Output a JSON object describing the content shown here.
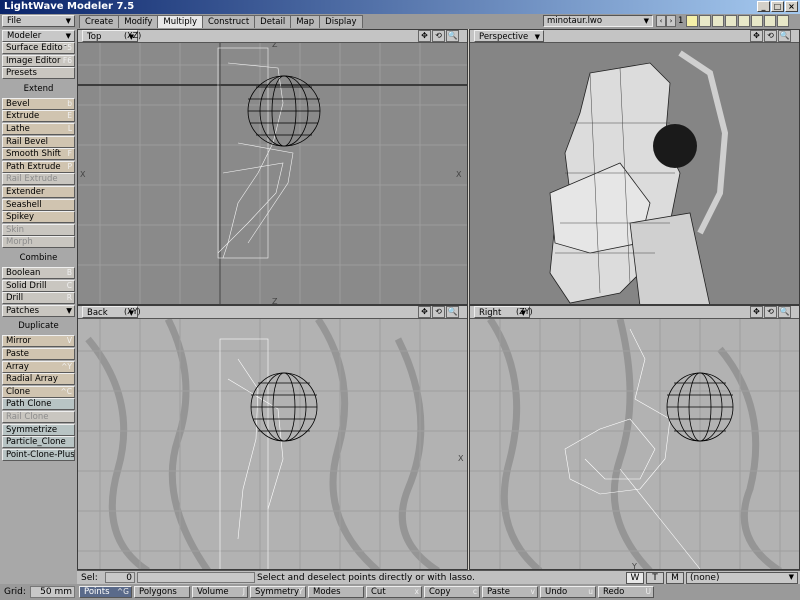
{
  "window": {
    "title": "LightWave Modeler 7.5",
    "min_glyph": "_",
    "max_glyph": "□",
    "close_glyph": "×"
  },
  "toolbar": {
    "file": "File",
    "modeler": "Modeler",
    "tabs": [
      "Create",
      "Modify",
      "Multiply",
      "Construct",
      "Detail",
      "Map",
      "Display"
    ],
    "active_tab": "Multiply",
    "object": "minotaur.lwo",
    "prev_arrow": "‹",
    "next_arrow": "›",
    "layer_number": "1"
  },
  "sidebar": {
    "top_items": [
      {
        "label": "Surface Editor",
        "key": "F5"
      },
      {
        "label": "Image Editor",
        "key": "F6"
      },
      {
        "label": "Presets",
        "key": ""
      }
    ],
    "groups": [
      {
        "title": "Extend",
        "items": [
          {
            "label": "Bevel",
            "key": "b",
            "state": "orange"
          },
          {
            "label": "Extrude",
            "key": "E",
            "state": "orange"
          },
          {
            "label": "Lathe",
            "key": "L",
            "state": "orange"
          },
          {
            "label": "Rail Bevel",
            "key": "",
            "state": "orange"
          },
          {
            "label": "Smooth Shift",
            "key": "F",
            "state": "orange"
          },
          {
            "label": "Path Extrude",
            "key": "P",
            "state": "orange"
          },
          {
            "label": "Rail Extrude",
            "key": "",
            "state": "disabled"
          },
          {
            "label": "Extender",
            "key": "",
            "state": "orange"
          },
          {
            "label": "Seashell",
            "key": "",
            "state": "orange"
          },
          {
            "label": "Spikey",
            "key": "",
            "state": "orange"
          },
          {
            "label": "Skin",
            "key": "",
            "state": "disabled"
          },
          {
            "label": "Morph",
            "key": "",
            "state": "disabled"
          }
        ]
      },
      {
        "title": "Combine",
        "items": [
          {
            "label": "Boolean",
            "key": "B",
            "state": "normal"
          },
          {
            "label": "Solid Drill",
            "key": "C",
            "state": "normal"
          },
          {
            "label": "Drill",
            "key": "R",
            "state": "normal"
          },
          {
            "label": "Patches",
            "key": "",
            "state": "dropdown"
          }
        ]
      },
      {
        "title": "Duplicate",
        "items": [
          {
            "label": "Mirror",
            "key": "V",
            "state": "orange"
          },
          {
            "label": "Paste",
            "key": "",
            "state": "orange"
          },
          {
            "label": "Array",
            "key": "^Y",
            "state": "orange"
          },
          {
            "label": "Radial Array",
            "key": "",
            "state": "orange"
          },
          {
            "label": "Clone",
            "key": "^C",
            "state": "orange"
          },
          {
            "label": "Path Clone",
            "key": "",
            "state": "teal"
          },
          {
            "label": "Rail Clone",
            "key": "",
            "state": "disabled"
          },
          {
            "label": "Symmetrize",
            "key": "",
            "state": "teal"
          },
          {
            "label": "Particle_Clone",
            "key": "",
            "state": "teal"
          },
          {
            "label": "Point-Clone-Plus+",
            "key": "",
            "state": "teal"
          }
        ]
      }
    ],
    "grid_label": "Grid:",
    "grid_value": "50 mm"
  },
  "viewports": [
    {
      "id": "top",
      "name": "Top",
      "axes": "(XZ)"
    },
    {
      "id": "perspective",
      "name": "Perspective",
      "axes": ""
    },
    {
      "id": "back",
      "name": "Back",
      "axes": "(XY)"
    },
    {
      "id": "right",
      "name": "Right",
      "axes": "(ZY)"
    }
  ],
  "viewport_labels": {
    "z": "Z",
    "x": "X",
    "y": "Y"
  },
  "viewport_controls": {
    "move": "✥",
    "rotate": "⟲",
    "zoom": "🔍",
    "max": "□"
  },
  "status": {
    "sel_label": "Sel:",
    "sel_value": "0",
    "message": "Select and deselect points directly or with lasso.",
    "w": "W",
    "t": "T",
    "m": "M",
    "surface": "(none)"
  },
  "bottombar": {
    "items": [
      {
        "label": "Points",
        "key": "^G",
        "active": true
      },
      {
        "label": "Polygons",
        "key": "",
        "active": false
      },
      {
        "label": "Volume",
        "key": "J",
        "active": false
      },
      {
        "label": "Symmetry",
        "key": "Y",
        "active": false
      },
      {
        "label": "Modes",
        "key": "",
        "active": false
      },
      {
        "label": "Cut",
        "key": "x",
        "active": false
      },
      {
        "label": "Copy",
        "key": "c",
        "active": false
      },
      {
        "label": "Paste",
        "key": "v",
        "active": false
      },
      {
        "label": "Undo",
        "key": "u",
        "active": false
      },
      {
        "label": "Redo",
        "key": "U",
        "active": false
      }
    ]
  }
}
